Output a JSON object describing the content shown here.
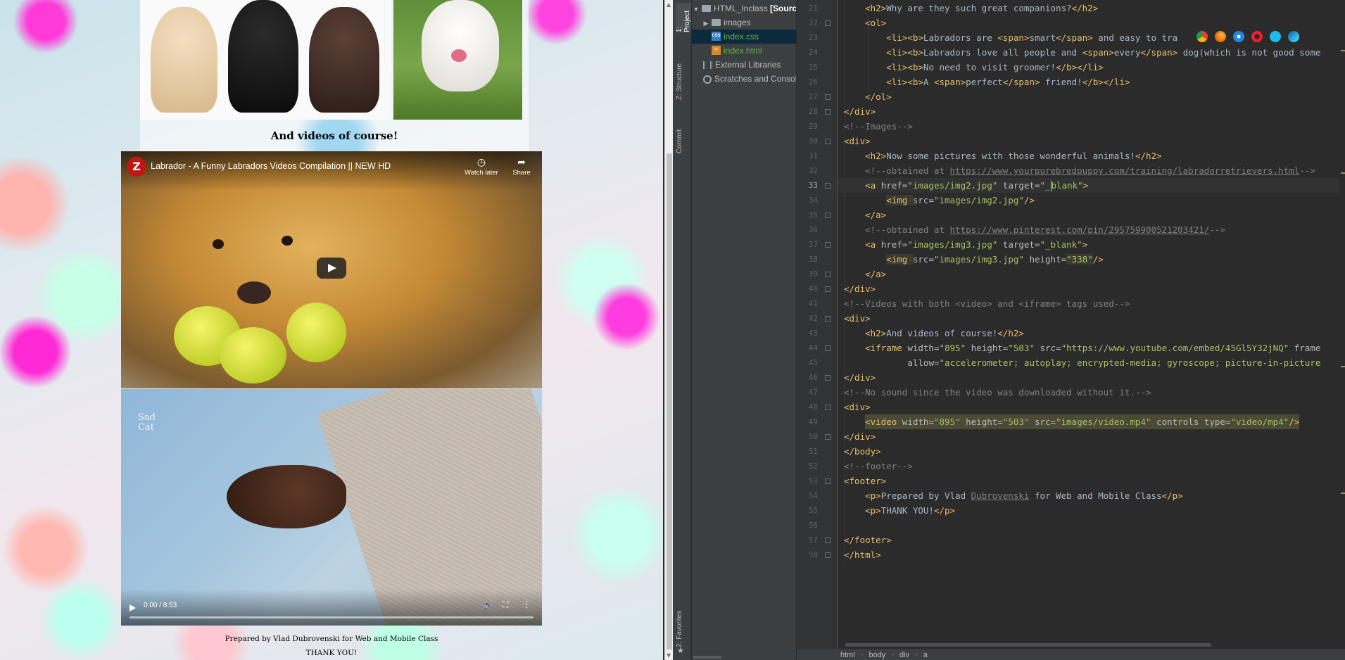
{
  "browser": {
    "videos_heading": "And videos of course!",
    "youtube": {
      "avatar_letter": "Z",
      "title": "Labrador - A Funny Labradors Videos Compilation || NEW HD",
      "watch_later": "Watch later",
      "share": "Share"
    },
    "video": {
      "watermark_line1": "Sad",
      "watermark_line2": "Cat",
      "time": "0:00 / 8:53",
      "progress_fraction": 0
    },
    "footer": {
      "line1": "Prepared by Vlad Dubrovenski for Web and Mobile Class",
      "line2": "THANK YOU!"
    }
  },
  "ide": {
    "tool_windows": {
      "project": "1: Project",
      "structure": "Z: Structure",
      "commit": "Commit",
      "favorites": "2: Favorites"
    },
    "project_tree": {
      "root": "HTML_Inclass",
      "root_suffix": "[Source",
      "items": [
        "images",
        "index.css",
        "index.html",
        "External Libraries",
        "Scratches and Consoles"
      ]
    },
    "line_numbers": [
      "21",
      "22",
      "23",
      "24",
      "25",
      "26",
      "27",
      "28",
      "29",
      "30",
      "31",
      "32",
      "33",
      "34",
      "35",
      "36",
      "37",
      "38",
      "39",
      "40",
      "41",
      "42",
      "43",
      "44",
      "45",
      "46",
      "47",
      "48",
      "49",
      "50",
      "51",
      "52",
      "53",
      "54",
      "55",
      "56",
      "57",
      "58"
    ],
    "current_line": "33",
    "code": {
      "l21": [
        "<h2>",
        "Why are they such great companions?",
        "</h2>"
      ],
      "l22": [
        "<ol>"
      ],
      "l23": [
        "<li><b>",
        "Labradors are ",
        "<span>",
        "smart",
        "</span>",
        " and easy to tra"
      ],
      "l24": [
        "<li><b>",
        "Labradors love all people and ",
        "<span>",
        "every",
        "</span>",
        " dog(which is not good some"
      ],
      "l25": [
        "<li><b>",
        "No need to visit groomer!",
        "</b></li>"
      ],
      "l26": [
        "<li><b>",
        "A ",
        "<span>",
        "perfect",
        "</span>",
        " friend!",
        "</b></li>"
      ],
      "l27": [
        "</ol>"
      ],
      "l28": [
        "</div>"
      ],
      "l29": [
        "<!--Images-->"
      ],
      "l30": [
        "<div>"
      ],
      "l31": [
        "<h2>",
        "Now some pictures with those wonderful animals!",
        "</h2>"
      ],
      "l32": [
        "<!--obtained at ",
        "https://www.yourpurebredpuppy.com/training/labradorretrievers.html",
        "-->"
      ],
      "l33": [
        "<a ",
        "href=",
        "\"images/img2.jpg\"",
        " target=",
        "\"_",
        "blank\"",
        ">"
      ],
      "l34": [
        "<img ",
        "src=",
        "\"images/img2.jpg\"",
        "/>"
      ],
      "l35": [
        "</a>"
      ],
      "l36": [
        "<!--obtained at ",
        "https://www.pinterest.com/pin/295759900521203421/",
        "-->"
      ],
      "l37": [
        "<a ",
        "href=",
        "\"images/img3.jpg\"",
        " target=",
        "\"_blank\"",
        ">"
      ],
      "l38": [
        "<img ",
        "src=",
        "\"images/img3.jpg\"",
        " height=",
        "\"338\"",
        "/>"
      ],
      "l39": [
        "</a>"
      ],
      "l40": [
        "</div>"
      ],
      "l41": [
        "<!--Videos with both <video> and <iframe> tags used-->"
      ],
      "l42": [
        "<div>"
      ],
      "l43": [
        "<h2>",
        "And videos of course!",
        "</h2>"
      ],
      "l44": [
        "<iframe ",
        "width=",
        "\"895\"",
        " height=",
        "\"503\"",
        " src=",
        "\"https://www.youtube.com/embed/45Gl5Y32jNQ\"",
        " frame"
      ],
      "l45": [
        "allow=",
        "\"accelerometer; autoplay; encrypted-media; gyroscope; picture-in-picture"
      ],
      "l46": [
        "</div>"
      ],
      "l47": [
        "<!--No sound since the video was downloaded without it.-->"
      ],
      "l48": [
        "<div>"
      ],
      "l49": [
        "<video ",
        "width=",
        "\"895\"",
        " height=",
        "\"503\"",
        " src=",
        "\"images/video.mp4\"",
        " controls ",
        "type=",
        "\"video/mp4\"",
        "/>"
      ],
      "l50": [
        "</div>"
      ],
      "l51": [
        "</body>"
      ],
      "l52": [
        "<!--footer-->"
      ],
      "l53": [
        "<footer>"
      ],
      "l54": [
        "<p>",
        "Prepared by Vlad ",
        "Dubrovenski",
        " for Web and Mobile Class",
        "</p>"
      ],
      "l55": [
        "<p>",
        "THANK YOU!",
        "</p>"
      ],
      "l56": [
        ""
      ],
      "l57": [
        "</footer>"
      ],
      "l58": [
        "</html>"
      ]
    },
    "browser_icons": [
      "chrome-icon",
      "firefox-icon",
      "safari-icon",
      "opera-icon",
      "internet-explorer-icon",
      "edge-icon"
    ],
    "breadcrumb": [
      "html",
      "body",
      "div",
      "a"
    ]
  },
  "colors": {
    "ide_background": "#2b2b2b",
    "tag": "#e8bf6a",
    "string": "#a5c261",
    "comment": "#808080",
    "text": "#a9b7c6"
  }
}
